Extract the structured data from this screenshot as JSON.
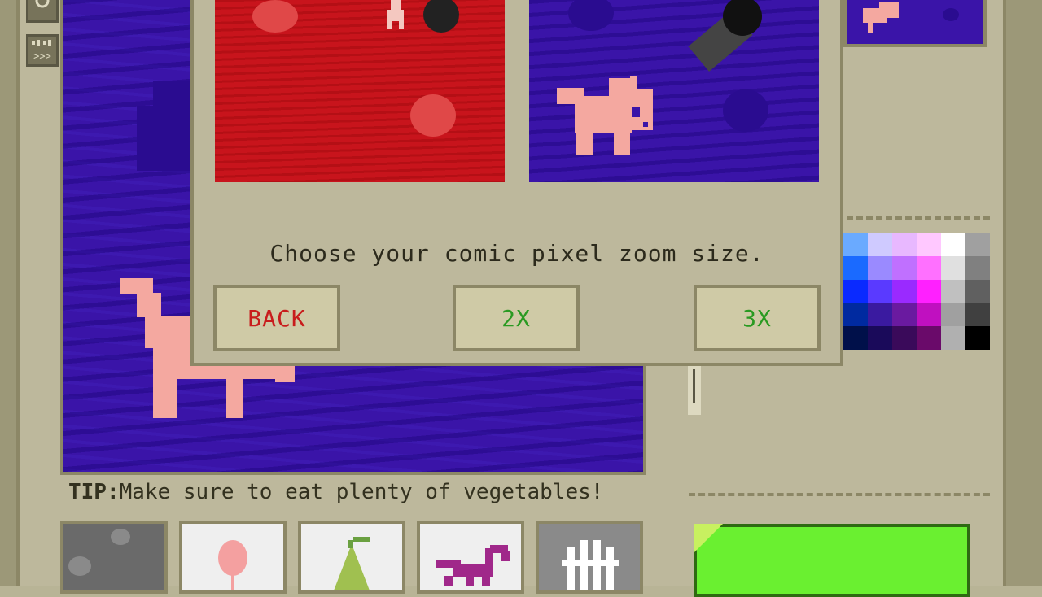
{
  "dialog": {
    "prompt": "Choose your comic pixel zoom size.",
    "buttons": {
      "back": "BACK",
      "zoom_2x": "2X",
      "zoom_3x": "3X"
    }
  },
  "tip": {
    "label": "TIP:",
    "text": "Make sure to eat plenty of vegetables!"
  },
  "toolbar": {
    "shuffle_label": "»›»"
  },
  "stickers": [
    {
      "name": "rocks-sticker"
    },
    {
      "name": "balloon-sticker"
    },
    {
      "name": "pear-sticker"
    },
    {
      "name": "scorpion-sticker"
    },
    {
      "name": "fence-sticker"
    }
  ],
  "colors": {
    "canvas_bg": "#3a14a8",
    "red_bg": "#c8141c",
    "creature": "#f4a8a0",
    "back_text": "#c81c1c",
    "zoom_text": "#2a9a22",
    "green_panel": "#6af030"
  },
  "palette": [
    "#6aaaff",
    "#cfcaff",
    "#e8b8ff",
    "#ffc8ff",
    "#ffffff",
    "#a0a0a0",
    "#1a6aff",
    "#9a8aff",
    "#c070ff",
    "#ff70ff",
    "#e0e0e0",
    "#808080",
    "#0a2aff",
    "#5a3aff",
    "#9a2aff",
    "#ff20ff",
    "#c0c0c0",
    "#606060",
    "#002aa0",
    "#3a1aa0",
    "#6a1aa0",
    "#c010c0",
    "#a0a0a0",
    "#404040",
    "#00104a",
    "#1a0a5a",
    "#3a0a5a",
    "#6a0a6a",
    "#b0b0b0",
    "#000000"
  ]
}
